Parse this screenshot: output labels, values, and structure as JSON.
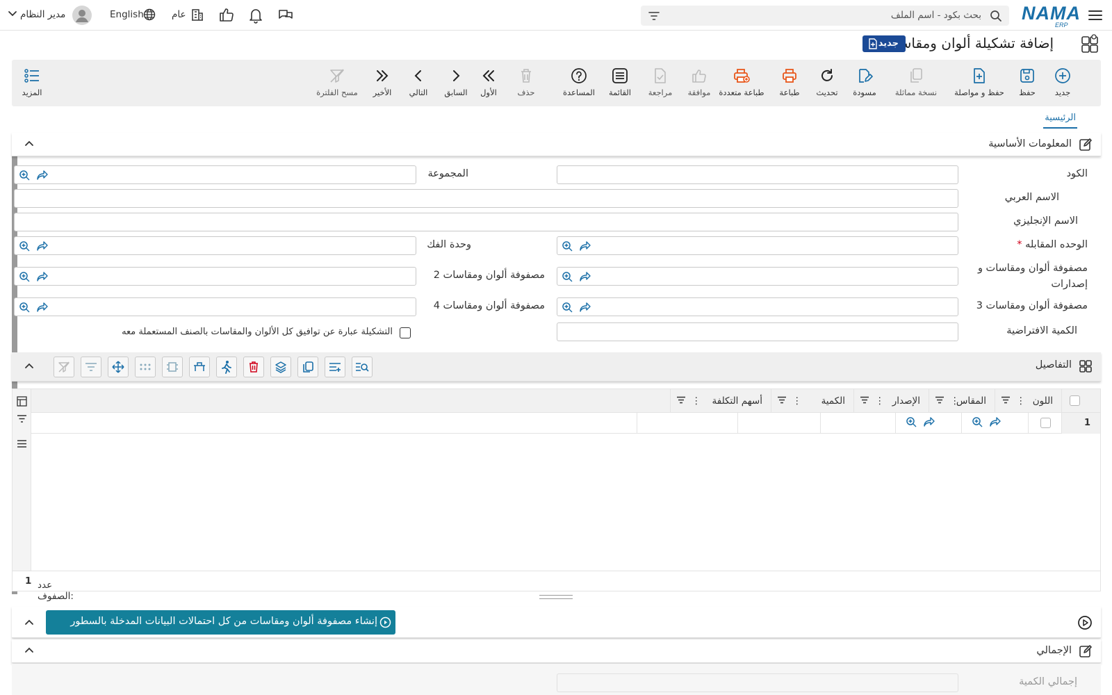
{
  "topbar": {
    "brand": "NAMA",
    "brand_sub": "ERP",
    "search_placeholder": "بحث بكود - اسم الملف",
    "language": "English",
    "branch": "عام",
    "user": "مدير النظام"
  },
  "page": {
    "title": "إضافة تشكيلة ألوان ومقاسات",
    "badge": "جديد"
  },
  "toolbar": {
    "new": "جديد",
    "save": "حفظ",
    "save_continue": "حفظ و مواصلة",
    "duplicate": "نسخة مماثلة",
    "draft": "مسودة",
    "refresh": "تحديث",
    "print": "طباعة",
    "multi_print": "طباعة متعددة",
    "approve": "موافقة",
    "review": "مراجعة",
    "list": "القائمة",
    "help": "المساعدة",
    "delete": "حذف",
    "first": "الأول",
    "previous": "السابق",
    "next": "التالي",
    "last": "الأخير",
    "clear_filter": "مسح الفلترة",
    "more": "المزيد"
  },
  "tabs": {
    "main": "الرئيسية"
  },
  "basic": {
    "title": "المعلومات الأساسية",
    "code": "الكود",
    "group": "المجموعة",
    "arabic_name": "الاسم العربي",
    "english_name": "الاسم الإنجليزي",
    "unit": "الوحده المقابله",
    "unit_required": "*",
    "break_unit": "وحدة الفك",
    "matrix_1": "مصفوفة ألوان ومقاسات و إصدارات",
    "matrix_2": "2 مصفوفة ألوان ومقاسات",
    "matrix_3": "3 مصفوفة ألوان ومقاسات",
    "matrix_4": "4 مصفوفة ألوان ومقاسات",
    "default_qty": "الكمية الافتراضية",
    "compat_check": "التشكيلة عبارة عن توافيق كل الألوان والمقاسات بالصنف المستعملة معه"
  },
  "details": {
    "title": "التفاصيل",
    "columns": [
      "اللون",
      "المقاس",
      "الإصدار",
      "الكمية",
      "أسهم التكلفة"
    ],
    "rows": [
      {
        "num": "1"
      }
    ],
    "row_count_label": "عدد الصفوف:",
    "row_count": "1"
  },
  "generate": {
    "label": "إنشاء مصفوفة ألوان ومقاسات من كل احتمالات البيانات المدخلة بالسطور"
  },
  "totals": {
    "title": "الإجمالي",
    "total_qty": "إجمالي الكمية"
  },
  "colors": {
    "accent": "#1a6fa8",
    "orange": "#e8561a",
    "badge": "#1b4a96",
    "generate": "#14809a",
    "required": "#d0021b"
  }
}
